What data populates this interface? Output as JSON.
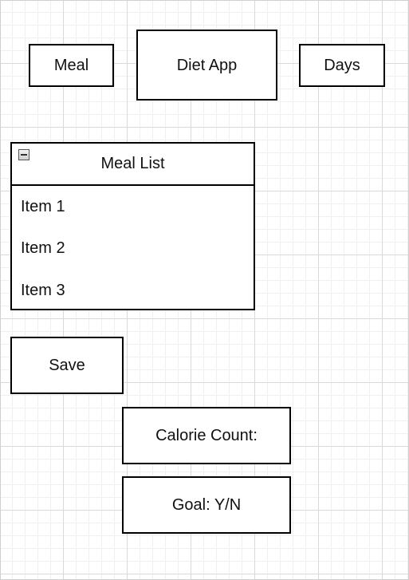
{
  "header": {
    "meal_label": "Meal",
    "title": "Diet App",
    "days_label": "Days"
  },
  "meal_list": {
    "title": "Meal List",
    "items": [
      "Item 1",
      "Item 2",
      "Item 3"
    ]
  },
  "actions": {
    "save_label": "Save"
  },
  "stats": {
    "calorie_label": "Calorie Count:",
    "goal_label": "Goal: Y/N"
  }
}
